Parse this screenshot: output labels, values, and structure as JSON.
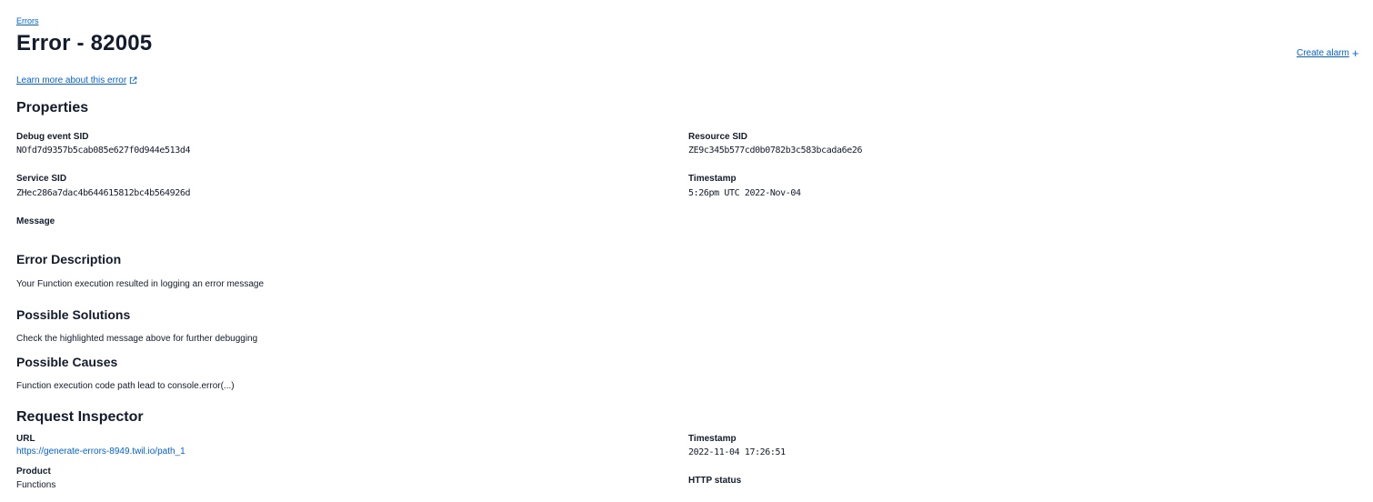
{
  "breadcrumb": {
    "label": "Errors"
  },
  "page_title": "Error - 82005",
  "create_alarm": {
    "label": "Create alarm",
    "icon": "plus-icon"
  },
  "learn_more": {
    "label": "Learn more about this error",
    "icon": "external-link-icon"
  },
  "properties": {
    "heading": "Properties",
    "debug_event_sid": {
      "label": "Debug event SID",
      "value": "NOfd7d9357b5cab085e627f0d944e513d4"
    },
    "resource_sid": {
      "label": "Resource SID",
      "value": "ZE9c345b577cd0b0782b3c583bcada6e26"
    },
    "service_sid": {
      "label": "Service SID",
      "value": "ZHec286a7dac4b644615812bc4b564926d"
    },
    "timestamp": {
      "label": "Timestamp",
      "value": "5:26pm UTC 2022-Nov-04"
    },
    "message": {
      "label": "Message"
    }
  },
  "error_description": {
    "heading": "Error Description",
    "text": "Your Function execution resulted in logging an error message"
  },
  "possible_solutions": {
    "heading": "Possible Solutions",
    "text": "Check the highlighted message above for further debugging"
  },
  "possible_causes": {
    "heading": "Possible Causes",
    "text": "Function execution code path lead to console.error(...)"
  },
  "request_inspector": {
    "heading": "Request Inspector",
    "url": {
      "label": "URL",
      "value": "https://generate-errors-8949.twil.io/path_1"
    },
    "timestamp": {
      "label": "Timestamp",
      "value": "2022-11-04 17:26:51"
    },
    "product": {
      "label": "Product",
      "value": "Functions"
    },
    "http_status": {
      "label": "HTTP status"
    }
  },
  "colors": {
    "link": "#0263e0",
    "text": "#121c2d"
  }
}
